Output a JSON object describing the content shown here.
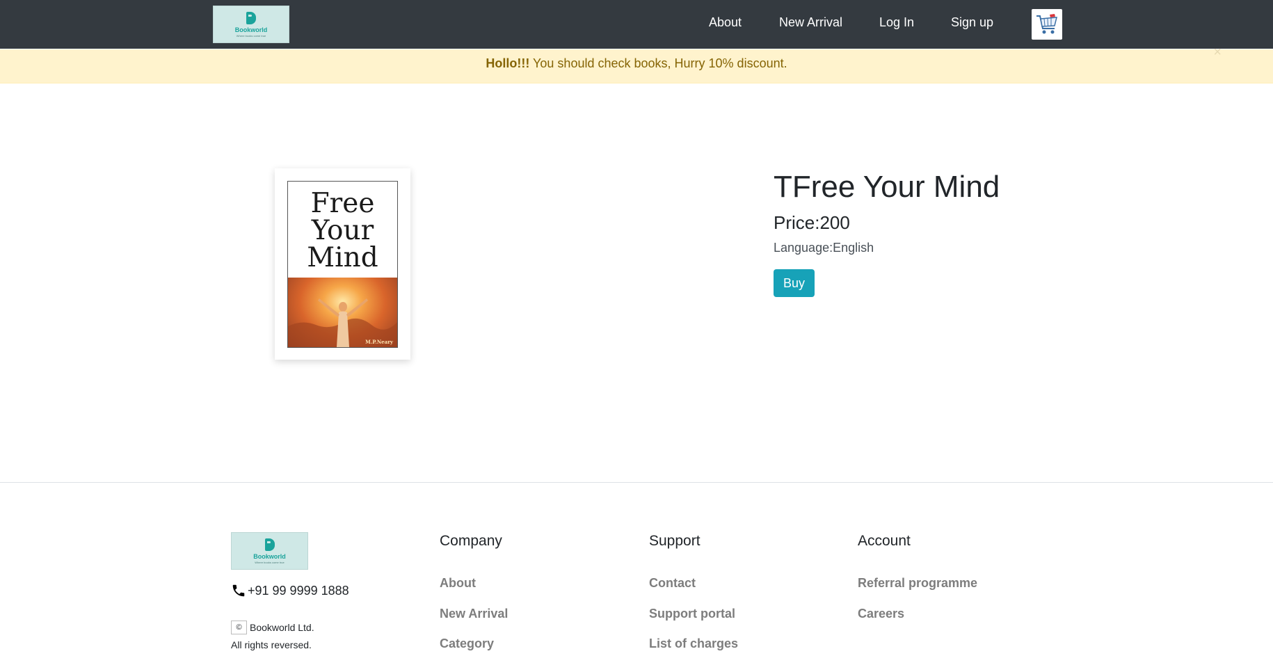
{
  "navbar": {
    "logo_text": "Bookworld",
    "logo_tagline": "Where books come true",
    "links": [
      "About",
      "New Arrival",
      "Log In",
      "Sign up"
    ],
    "cart_icon": "shopping-cart-icon"
  },
  "alert": {
    "strong": "Hollo!!!",
    "message": " You should check books, Hurry 10% discount.",
    "close": "×"
  },
  "product": {
    "cover": {
      "title": "Free Your Mind",
      "author": "M.P.Neary"
    },
    "title": "TFree Your Mind",
    "price": "Price:200",
    "language": "Language:English",
    "buy_label": "Buy"
  },
  "footer": {
    "logo_text": "Bookworld",
    "logo_tagline": "Where books come true",
    "phone": "+91 99 9999 1888",
    "copyright_symbol": "©",
    "company_name": "Bookworld Ltd.",
    "rights": "All rights reversed.",
    "columns": [
      {
        "heading": "Company",
        "links": [
          "About",
          "New Arrival",
          "Category"
        ]
      },
      {
        "heading": "Support",
        "links": [
          "Contact",
          "Support portal",
          "List of charges"
        ]
      },
      {
        "heading": "Account",
        "links": [
          "Referral programme",
          "Careers"
        ]
      }
    ]
  },
  "colors": {
    "navbar_bg": "#343a40",
    "alert_bg": "#fff3cd",
    "alert_text": "#856404",
    "buy_button": "#17a2b8",
    "footer_link": "#7d7d7d"
  }
}
